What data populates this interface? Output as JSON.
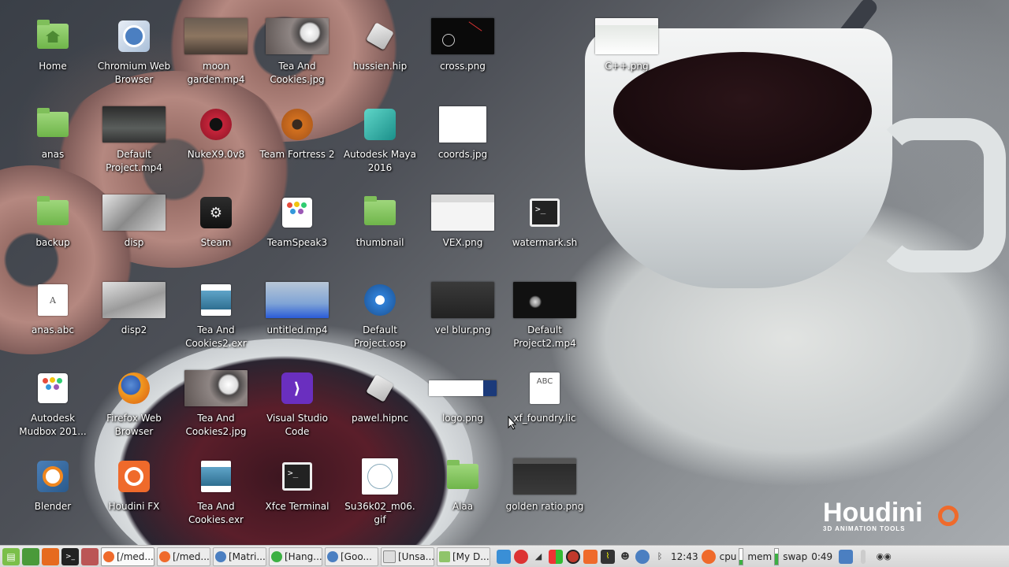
{
  "desktop": {
    "icons": [
      {
        "id": "home",
        "label": "Home",
        "type": "home-folder"
      },
      {
        "id": "chromium",
        "label": "Chromium Web Browser",
        "type": "chromium"
      },
      {
        "id": "moon-garden",
        "label": "moon garden.mp4",
        "type": "video"
      },
      {
        "id": "tea-jpg",
        "label": "Tea And Cookies.jpg",
        "type": "image"
      },
      {
        "id": "hussien",
        "label": "hussien.hip",
        "type": "hip"
      },
      {
        "id": "cross",
        "label": "cross.png",
        "type": "image"
      },
      {
        "id": "cpp",
        "label": "C++.png",
        "type": "image"
      },
      {
        "id": "anas",
        "label": "anas",
        "type": "folder"
      },
      {
        "id": "default-project",
        "label": "Default Project.mp4",
        "type": "video"
      },
      {
        "id": "nuke",
        "label": "NukeX9.0v8",
        "type": "nuke"
      },
      {
        "id": "tf2",
        "label": "Team Fortress 2",
        "type": "tf2"
      },
      {
        "id": "maya",
        "label": "Autodesk Maya 2016",
        "type": "maya"
      },
      {
        "id": "coords",
        "label": "coords.jpg",
        "type": "image"
      },
      {
        "id": "backup",
        "label": "backup",
        "type": "folder"
      },
      {
        "id": "disp",
        "label": "disp",
        "type": "image"
      },
      {
        "id": "steam",
        "label": "Steam",
        "type": "steam"
      },
      {
        "id": "teamspeak",
        "label": "TeamSpeak3",
        "type": "dots"
      },
      {
        "id": "thumbnail",
        "label": "thumbnail",
        "type": "folder"
      },
      {
        "id": "vex",
        "label": "VEX.png",
        "type": "image"
      },
      {
        "id": "watermark-sh",
        "label": "watermark.sh",
        "type": "terminal"
      },
      {
        "id": "anas-abc",
        "label": "anas.abc",
        "type": "doc"
      },
      {
        "id": "disp2",
        "label": "disp2",
        "type": "image"
      },
      {
        "id": "tea-exr2",
        "label": "Tea And Cookies2.exr",
        "type": "exr"
      },
      {
        "id": "untitled",
        "label": "untitled.mp4",
        "type": "video"
      },
      {
        "id": "default-osp",
        "label": "Default Project.osp",
        "type": "osp"
      },
      {
        "id": "vel-blur",
        "label": "vel blur.png",
        "type": "image"
      },
      {
        "id": "default-project2",
        "label": "Default Project2.mp4",
        "type": "video"
      },
      {
        "id": "mudbox",
        "label": "Autodesk Mudbox 201...",
        "type": "dots"
      },
      {
        "id": "firefox",
        "label": "Firefox Web Browser",
        "type": "firefox"
      },
      {
        "id": "tea-jpg2",
        "label": "Tea And Cookies2.jpg",
        "type": "image"
      },
      {
        "id": "vscode",
        "label": "Visual Studio Code",
        "type": "vscode"
      },
      {
        "id": "pawel",
        "label": "pawel.hipnc",
        "type": "hip"
      },
      {
        "id": "logo",
        "label": "logo.png",
        "type": "image"
      },
      {
        "id": "xf-foundry",
        "label": "xf_foundry.lic",
        "type": "abc"
      },
      {
        "id": "blender",
        "label": "Blender",
        "type": "blender"
      },
      {
        "id": "houdini",
        "label": "Houdini FX",
        "type": "houdini"
      },
      {
        "id": "tea-exr",
        "label": "Tea And Cookies.exr",
        "type": "exr"
      },
      {
        "id": "xfce-terminal",
        "label": "Xfce Terminal",
        "type": "terminal"
      },
      {
        "id": "su36",
        "label": "Su36k02_m06. gif",
        "type": "gif"
      },
      {
        "id": "alaa",
        "label": "Alaa",
        "type": "folder"
      },
      {
        "id": "golden-ratio",
        "label": "golden ratio.png",
        "type": "image"
      }
    ],
    "watermark": {
      "title": "Houdini",
      "subtitle": "3D ANIMATION TOOLS"
    }
  },
  "panel": {
    "tasks": [
      {
        "label": "[/med...",
        "icon": "houdini"
      },
      {
        "label": "[/med...",
        "icon": "houdini"
      },
      {
        "label": "[Matri...",
        "icon": "chromium"
      },
      {
        "label": "[Hang...",
        "icon": "hangouts"
      },
      {
        "label": "[Goo...",
        "icon": "chromium"
      },
      {
        "label": "[Unsa...",
        "icon": "window"
      },
      {
        "label": "[My D...",
        "icon": "folder"
      }
    ],
    "clock": "12:43",
    "cpu_label": "cpu",
    "mem_label": "mem",
    "swap_label": "swap",
    "swap_value": "0:49",
    "colors": {
      "accent": "#ef6a2b",
      "folder": "#6fb54a",
      "panel": "#e0e0e0"
    }
  }
}
